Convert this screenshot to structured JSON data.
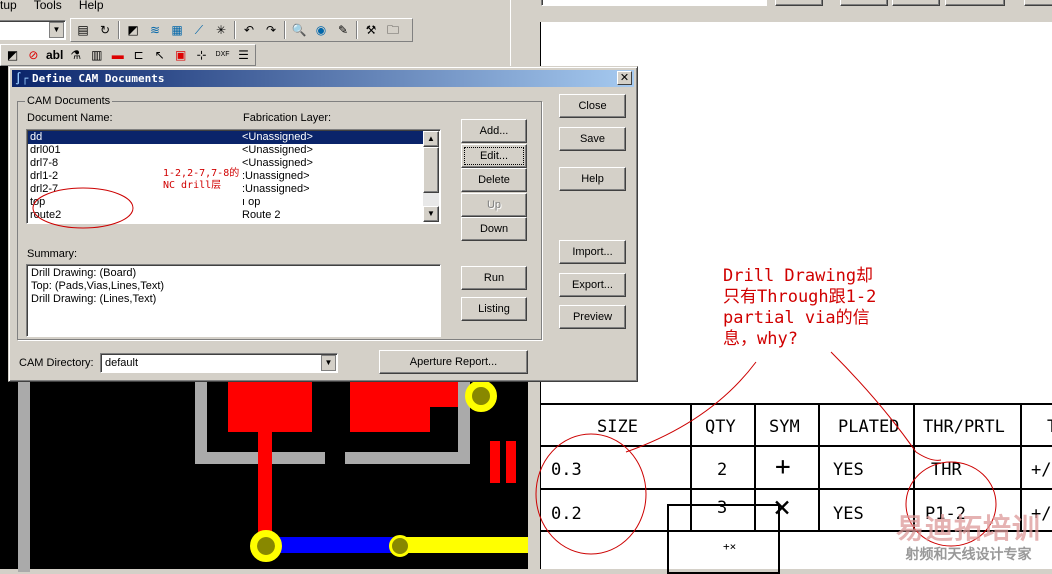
{
  "menu": [
    "tup",
    "Tools",
    "Help"
  ],
  "toolbar_icons": [
    "properties-icon",
    "redraw-icon",
    "select-icon",
    "pour-icon",
    "plane-icon",
    "route-icon",
    "cluster-icon",
    "undo-icon",
    "redo-icon",
    "zoom-icon",
    "view-icon",
    "paint-icon",
    "hammer-icon",
    "open-icon"
  ],
  "toolbar2_icons": [
    "select-icon",
    "drc-icon",
    "text-icon",
    "eco-icon",
    "library-icon",
    "copper-icon",
    "outline-icon",
    "pointer-icon",
    "board-icon",
    "dimension-icon",
    "dxf-icon",
    "report-icon"
  ],
  "toolbar2_text": {
    "text": "abl",
    "dxf": "DXF"
  },
  "dialog": {
    "title": "Define CAM Documents",
    "group_label": "CAM Documents",
    "col_doc": "Document Name:",
    "col_fab": "Fabrication Layer:",
    "documents": [
      {
        "name": "dd",
        "layer": "<Unassigned>"
      },
      {
        "name": "drl001",
        "layer": "<Unassigned>"
      },
      {
        "name": "drl7-8",
        "layer": "<Unassigned>"
      },
      {
        "name": "drl1-2",
        "layer": ":Unassigned>"
      },
      {
        "name": "drl2-7",
        "layer": ":Unassigned>"
      },
      {
        "name": "top",
        "layer": "ı op"
      },
      {
        "name": "route2",
        "layer": "Route 2"
      }
    ],
    "buttons": {
      "add": "Add...",
      "edit": "Edit...",
      "delete": "Delete",
      "up": "Up",
      "down": "Down",
      "close": "Close",
      "save": "Save",
      "help": "Help",
      "import": "Import...",
      "export": "Export...",
      "preview": "Preview",
      "run": "Run",
      "listing": "Listing",
      "aperture": "Aperture Report..."
    },
    "summary_label": "Summary:",
    "summary": [
      "Drill Drawing: (Board)",
      "Top: (Pads,Vias,Lines,Text)",
      "Drill Drawing: (Lines,Text)"
    ],
    "cam_dir_label": "CAM Directory:",
    "cam_dir_value": "default"
  },
  "annotations": {
    "list_note": [
      "1-2,2-7,7-8的",
      "NC drill层"
    ],
    "drawing_note": [
      "Drill Drawing却",
      "只有Through跟1-2",
      "partial via的信",
      "息，why?"
    ]
  },
  "drill_table": {
    "headers": [
      "SIZE",
      "QTY",
      "SYM",
      "PLATED",
      "THR/PRTL",
      "T"
    ],
    "rows": [
      [
        "0.3",
        "2",
        "+",
        "YES",
        "THR",
        "+/"
      ],
      [
        "0.2",
        "3",
        "×",
        "YES",
        "P1-2",
        "+/"
      ]
    ]
  },
  "watermark": {
    "title": "易迪拓培训",
    "subtitle": "射频和天线设计专家"
  }
}
